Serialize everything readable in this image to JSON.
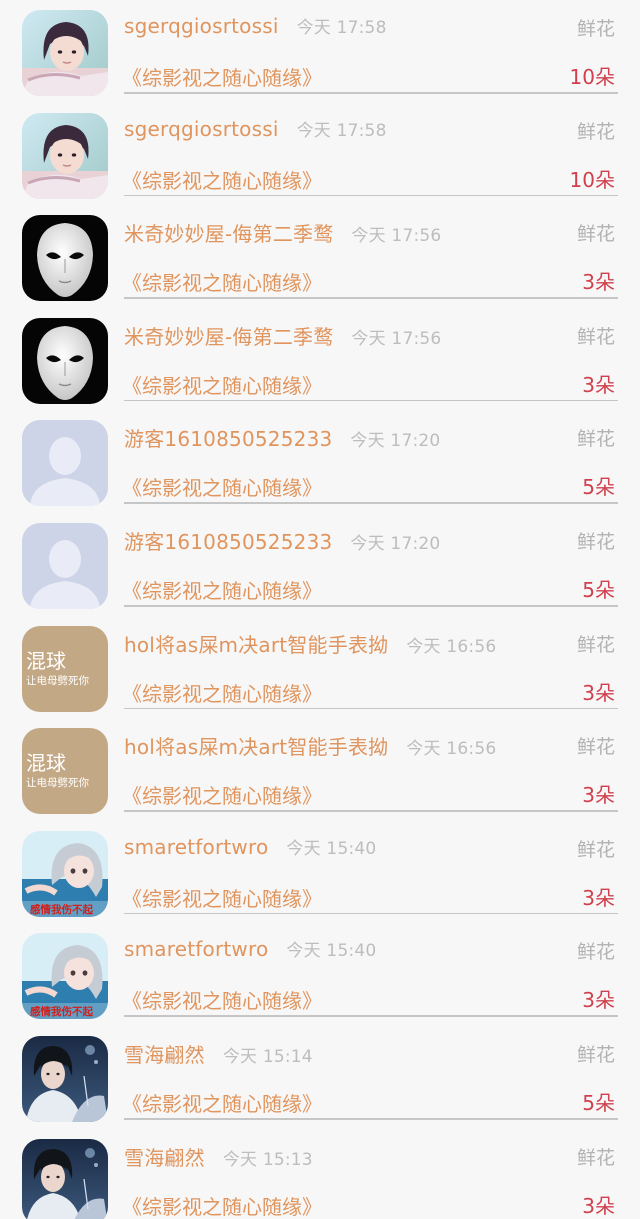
{
  "gift_list": {
    "items": [
      {
        "user": "sgerqgiosrtossi",
        "time": "今天 17:58",
        "gift": "鲜花",
        "work": "《综影视之随心随缘》",
        "quantity": "10朵",
        "avatar": "girl-photo"
      },
      {
        "user": "sgerqgiosrtossi",
        "time": "今天 17:58",
        "gift": "鲜花",
        "work": "《综影视之随心随缘》",
        "quantity": "10朵",
        "avatar": "girl-photo"
      },
      {
        "user": "米奇妙妙屋-侮第二季鹜",
        "time": "今天 17:56",
        "gift": "鲜花",
        "work": "《综影视之随心随缘》",
        "quantity": "3朵",
        "avatar": "white-mask"
      },
      {
        "user": "米奇妙妙屋-侮第二季鹜",
        "time": "今天 17:56",
        "gift": "鲜花",
        "work": "《综影视之随心随缘》",
        "quantity": "3朵",
        "avatar": "white-mask"
      },
      {
        "user": "游客1610850525233",
        "time": "今天 17:20",
        "gift": "鲜花",
        "work": "《综影视之随心随缘》",
        "quantity": "5朵",
        "avatar": "default-user"
      },
      {
        "user": "游客1610850525233",
        "time": "今天 17:20",
        "gift": "鲜花",
        "work": "《综影视之随心随缘》",
        "quantity": "5朵",
        "avatar": "default-user"
      },
      {
        "user": "hol将as屎m决art智能手表拗",
        "time": "今天 16:56",
        "gift": "鲜花",
        "work": "《综影视之随心随缘》",
        "quantity": "3朵",
        "avatar": "text-badge",
        "avatar_text_main": "混球",
        "avatar_text_sub": "让电母劈死你"
      },
      {
        "user": "hol将as屎m决art智能手表拗",
        "time": "今天 16:56",
        "gift": "鲜花",
        "work": "《综影视之随心随缘》",
        "quantity": "3朵",
        "avatar": "text-badge",
        "avatar_text_main": "混球",
        "avatar_text_sub": "让电母劈死你"
      },
      {
        "user": "smaretfortwro",
        "time": "今天 15:40",
        "gift": "鲜花",
        "work": "《综影视之随心随缘》",
        "quantity": "3朵",
        "avatar": "anime-girl",
        "avatar_caption": "感情我伤不起"
      },
      {
        "user": "smaretfortwro",
        "time": "今天 15:40",
        "gift": "鲜花",
        "work": "《综影视之随心随缘》",
        "quantity": "3朵",
        "avatar": "anime-girl",
        "avatar_caption": "感情我伤不起"
      },
      {
        "user": "雪海翩然",
        "time": "今天 15:14",
        "gift": "鲜花",
        "work": "《综影视之随心随缘》",
        "quantity": "5朵",
        "avatar": "drama-poster"
      },
      {
        "user": "雪海翩然",
        "time": "今天 15:13",
        "gift": "鲜花",
        "work": "《综影视之随心随缘》",
        "quantity": "3朵",
        "avatar": "drama-poster"
      }
    ]
  },
  "colors": {
    "name_accent": "#e0955e",
    "quantity_red": "#d0404e",
    "time_gray": "#bdbdbd",
    "background": "#f7f7f7"
  }
}
